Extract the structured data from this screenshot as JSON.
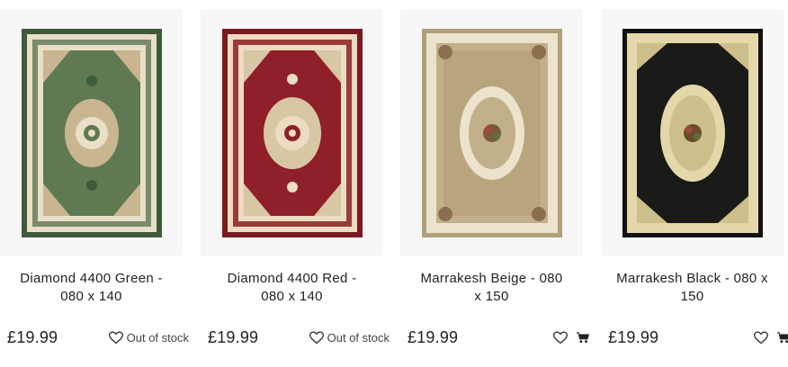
{
  "products": [
    {
      "title": "Diamond 4400 Green - 080 x 140",
      "title_line1": "Diamond 4400 Green -",
      "title_line2": "080 x 140",
      "price": "£19.99",
      "stock_text": "Out of stock",
      "image_colors": {
        "field": "#5f7a52",
        "border": "#3e5a3a",
        "accent": "#e9dfc6"
      }
    },
    {
      "title": "Diamond 4400 Red - 080 x 140",
      "title_line1": "Diamond 4400 Red -",
      "title_line2": "080 x 140",
      "price": "£19.99",
      "stock_text": "Out of stock",
      "image_colors": {
        "field": "#8f1f28",
        "border": "#7a1a22",
        "accent": "#ebdcc2"
      }
    },
    {
      "title": "Marrakesh Beige - 080 x 150",
      "title_line1": "Marrakesh Beige - 080",
      "title_line2": "x 150",
      "price": "£19.99",
      "stock_text": "",
      "image_colors": {
        "field": "#c2b08a",
        "border": "#b19f79",
        "accent": "#ece3cd"
      }
    },
    {
      "title": "Marrakesh Black - 080 x 150",
      "title_line1": "Marrakesh Black - 080 x",
      "title_line2": "150",
      "price": "£19.99",
      "stock_text": "",
      "image_colors": {
        "field": "#1a1a18",
        "border": "#111111",
        "accent": "#e4d7a9"
      }
    }
  ]
}
